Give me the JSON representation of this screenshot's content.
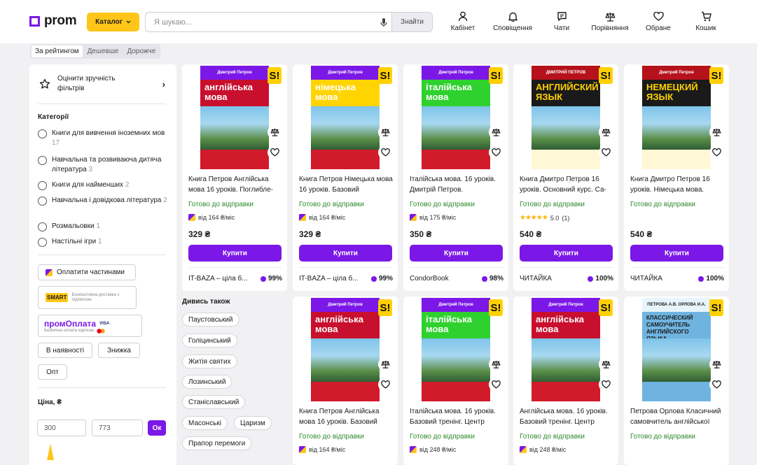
{
  "header": {
    "logo_text": "prom",
    "catalog_label": "Каталог",
    "search_placeholder": "Я шукаю...",
    "search_button": "Знайти",
    "nav": [
      {
        "label": "Кабінет",
        "icon": "person-icon"
      },
      {
        "label": "Сповіщення",
        "icon": "bell-icon"
      },
      {
        "label": "Чати",
        "icon": "chat-icon"
      },
      {
        "label": "Порівняння",
        "icon": "scales-icon"
      },
      {
        "label": "Обране",
        "icon": "heart-icon"
      },
      {
        "label": "Кошик",
        "icon": "cart-icon"
      }
    ]
  },
  "sort": {
    "tabs": [
      "За рейтингом",
      "Дешевше",
      "Дорожче"
    ],
    "active": "За рейтингом"
  },
  "sidebar": {
    "rate_label": "Оцінити зручність фільтрів",
    "categories_title": "Категорії",
    "categories": [
      {
        "label": "Книги для вивчення іноземних мов",
        "count": "17"
      },
      {
        "label": "Навчальна та розвиваюча дитяча література",
        "count": "3"
      },
      {
        "label": "Книги для найменших",
        "count": "2"
      },
      {
        "label": "Навчальна і довідкова література",
        "count": "2"
      },
      {
        "label": "Розмальовки",
        "count": "1"
      },
      {
        "label": "Настільні ігри",
        "count": "1"
      }
    ],
    "pay_parts": "Оплатити частинами",
    "smart_logo": "SMART",
    "smart_text": "Безкоштовна доставка з підпискою",
    "prompay_logo": "промОплата",
    "prompay_sub": "Безпечна оплата карткою",
    "prompay_cards": "VISA",
    "filters": [
      "В наявності",
      "Знижка",
      "Опт"
    ],
    "price_title": "Ціна, ₴",
    "price_min": "300",
    "price_max": "773",
    "price_ok": "Ок"
  },
  "products_row1": [
    {
      "title": "Книга Петров Англійська мова 16 уроків. Поглибле-",
      "status": "Готово до відправки",
      "credit": "від 164 ₴/міс",
      "price": "329 ₴",
      "buy": "Купити",
      "seller": "IT-BAZA – ціла б...",
      "seller_rating": "99%",
      "cover_author": "Дмитрий Петров",
      "cover_title": "англійська мова",
      "cover_color": "#c8102e"
    },
    {
      "title": "Книга Петров Німецька мова 16 уроків. Базовий",
      "status": "Готово до відправки",
      "credit": "від 164 ₴/міс",
      "price": "329 ₴",
      "buy": "Купити",
      "seller": "IT-BAZA – ціла б...",
      "seller_rating": "99%",
      "cover_author": "Дмитрий Петров",
      "cover_title": "німецька мова",
      "cover_color": "#ffd400"
    },
    {
      "title": "Італійська мова. 16 уроків. Дмитрій Петров.",
      "status": "Готово до відправки",
      "credit": "від 175 ₴/міс",
      "price": "350 ₴",
      "buy": "Купити",
      "seller": "CondorBook",
      "seller_rating": "98%",
      "cover_author": "Дмитрий Петров",
      "cover_title": "італійська мова",
      "cover_color": "#2fd12f"
    },
    {
      "title": "Книга Дмитро Петров 16 уроків. Основний курс. Са-",
      "status": "Готово до відправки",
      "rating_value": "5.0",
      "rating_count": "(1)",
      "price": "540 ₴",
      "buy": "Купити",
      "seller": "ЧИТАЙКА",
      "seller_rating": "100%",
      "cover_author": "ДМИТРИЙ ПЕТРОВ",
      "cover_title": "АНГЛИЙСКИЙ ЯЗЫК",
      "cover_color": "#1a1a1a"
    },
    {
      "title": "Книга Дмитро Петров 16 уроків. Німецька мова.",
      "status": "Готово до відправки",
      "price": "540 ₴",
      "buy": "Купити",
      "seller": "ЧИТАЙКА",
      "seller_rating": "100%",
      "cover_author": "Дмитрий Петров",
      "cover_title": "НЕМЕЦКИЙ ЯЗЫК",
      "cover_color": "#1a1a1a"
    }
  ],
  "see_also": {
    "title": "Дивись також",
    "tags": [
      "Паустовський",
      "Голіцинський",
      "Житія святих",
      "Лозинський",
      "Станіславський",
      "Масонські",
      "Царизм",
      "Прапор перемоги"
    ]
  },
  "products_row2": [
    {
      "title": "Книга Петров Англійська мова 16 уроків. Базовий",
      "status": "Готово до відправки",
      "credit": "від 164 ₴/міс",
      "cover_author": "Дмитрий Петров",
      "cover_title": "англійська мова",
      "cover_color": "#c8102e"
    },
    {
      "title": "Італійська мова. 16 уроків. Базовий тренінг. Центр",
      "status": "Готово до відправки",
      "credit": "від 248 ₴/міс",
      "cover_author": "Дмитрий Петров",
      "cover_title": "італійська мова",
      "cover_color": "#2fd12f"
    },
    {
      "title": "Англійська мова. 16 уроків. Базовий тренінг. Центр",
      "status": "Готово до відправки",
      "credit": "від 248 ₴/міс",
      "cover_author": "Дмитрий Петров",
      "cover_title": "англійська мова",
      "cover_color": "#c8102e"
    },
    {
      "title": "Петрова Орлова Класичний самовчитель англійської",
      "status": "Готово до відправки",
      "cover_author": "ПЕТРОВА А.В. ОРЛОВА И.А.",
      "cover_title": "КЛАССИЧЕСКИЙ САМОУЧИТЕЛЬ АНГЛИЙСКОГО ЯЗЫКА",
      "cover_color": "#ffffff"
    }
  ],
  "colors": {
    "accent": "#7b18e8",
    "catalog": "#ffc619",
    "ready": "#2c8b2c"
  }
}
